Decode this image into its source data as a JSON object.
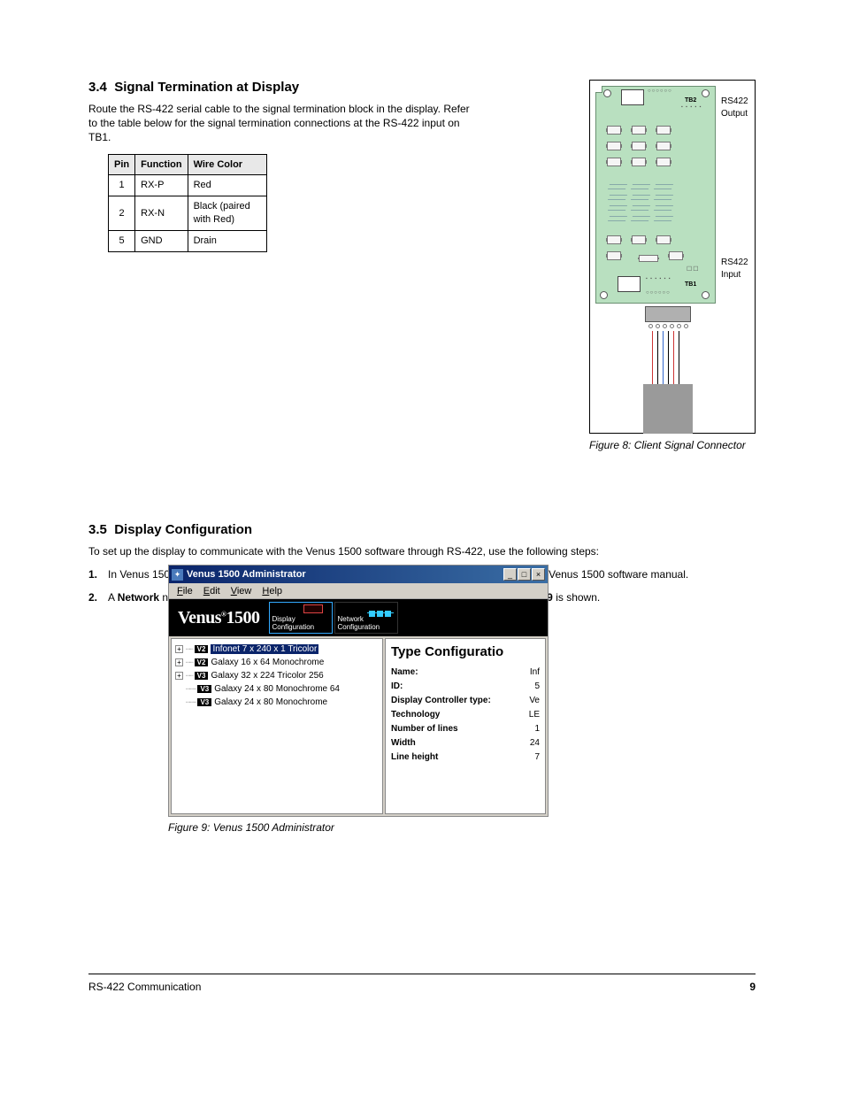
{
  "section1": {
    "heading_num": "3.4",
    "heading_text": "Signal Termination at Display",
    "para": "Route the RS-422 serial cable to the signal termination block in the display. Refer to the table below for the signal termination connections at the RS-422 input on TB1.",
    "table": {
      "h1": "Pin",
      "h2": "Function",
      "h3": "Wire Color",
      "rows": [
        {
          "pin": "1",
          "fn": "RX-P",
          "color": "Red"
        },
        {
          "pin": "2",
          "fn": "RX-N",
          "color": "Black (paired with Red)"
        },
        {
          "pin": "5",
          "fn": "GND",
          "color": "Drain"
        }
      ]
    }
  },
  "figure8": {
    "tb2": "TB2",
    "tb1": "TB1",
    "out1": "RS422",
    "out2": "Output",
    "in1": "RS422",
    "in2": "Input",
    "caption": "Figure 8: Client Signal Connector"
  },
  "section2": {
    "heading_num": "3.5",
    "heading_text": "Display Configuration",
    "intro": "To set up the display to communicate with the Venus 1500 software through RS-422, use the following steps:",
    "steps": [
      "In Venus 1500 Administrator, configure the Display Type and the Display as explained in the Venus 1500 software manual.",
      "A Network needs to be configured. Click Network Configuration. A screen similar to Figure 9 is shown."
    ]
  },
  "screenshot": {
    "title": "Venus 1500 Administrator",
    "menu": [
      "File",
      "Edit",
      "View",
      "Help"
    ],
    "logo": "Venus 1500",
    "btn1": "Display Configuration",
    "btn2": "Network Configuration",
    "tree": [
      {
        "exp": "+",
        "badge": "V2",
        "label": "Infonet 7 x 240 x 1 Tricolor",
        "sel": true
      },
      {
        "exp": "+",
        "badge": "V2",
        "label": "Galaxy 16 x 64 Monochrome",
        "sel": false
      },
      {
        "exp": "+",
        "badge": "V3",
        "label": "Galaxy 32 x 224 Tricolor 256",
        "sel": false
      },
      {
        "exp": "",
        "badge": "V3",
        "label": "Galaxy 24 x 80 Monochrome 64",
        "sel": false
      },
      {
        "exp": "",
        "badge": "V3",
        "label": "Galaxy 24 x 80 Monochrome",
        "sel": false
      }
    ],
    "panel_title": "Type Configuratio",
    "props": [
      {
        "k": "Name:",
        "v": "Inf"
      },
      {
        "k": "ID:",
        "v": "5"
      },
      {
        "k": "Display Controller type:",
        "v": "Ve"
      },
      {
        "k": "Technology",
        "v": "LE"
      },
      {
        "k": "Number of lines",
        "v": "1"
      },
      {
        "k": "Width",
        "v": "24"
      },
      {
        "k": "Line height",
        "v": "7"
      }
    ],
    "caption": "Figure 9: Venus 1500 Administrator"
  },
  "footer": {
    "left": "RS-422 Communication",
    "right": "9"
  }
}
